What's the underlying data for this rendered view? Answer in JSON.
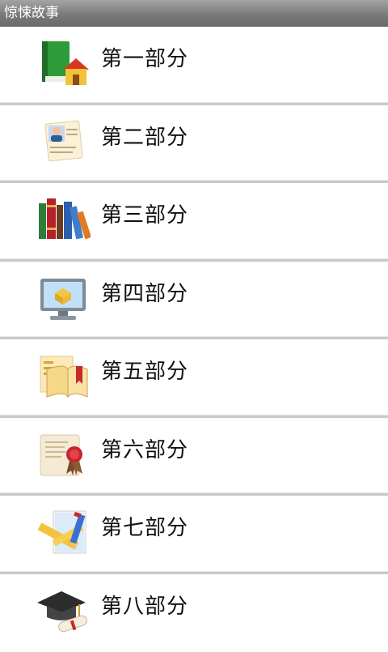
{
  "title": "惊悚故事",
  "items": [
    {
      "label": "第一部分",
      "icon": "book-home-icon"
    },
    {
      "label": "第二部分",
      "icon": "profile-card-icon"
    },
    {
      "label": "第三部分",
      "icon": "books-icon"
    },
    {
      "label": "第四部分",
      "icon": "monitor-icon"
    },
    {
      "label": "第五部分",
      "icon": "open-book-icon"
    },
    {
      "label": "第六部分",
      "icon": "certificate-seal-icon"
    },
    {
      "label": "第七部分",
      "icon": "ruler-pencil-icon"
    },
    {
      "label": "第八部分",
      "icon": "graduation-cap-icon"
    }
  ]
}
